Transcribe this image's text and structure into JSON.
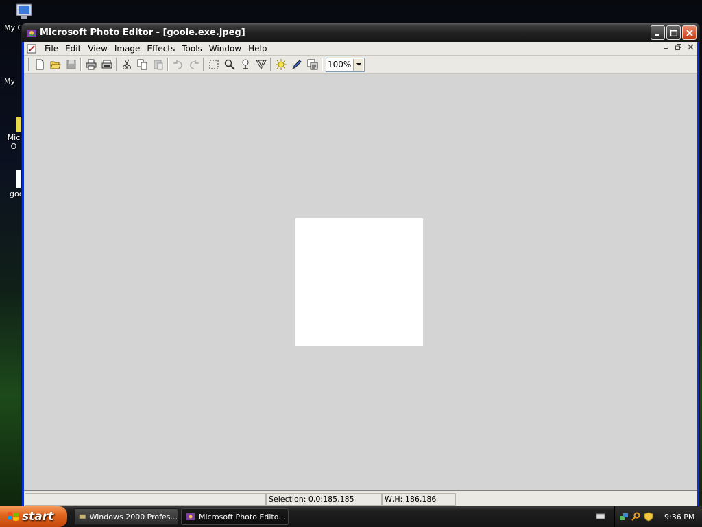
{
  "desktop": {
    "icons": [
      {
        "label": "My C",
        "icon": "my-computer-icon"
      },
      {
        "label": "My",
        "icon": "my-documents-icon"
      },
      {
        "label": "Mic O",
        "icon": "microsoft-outlook-icon"
      },
      {
        "label": "goo",
        "icon": "file-icon"
      }
    ]
  },
  "window": {
    "title": "Microsoft Photo Editor - [goole.exe.jpeg]",
    "buttons": {
      "minimize": "minimize-icon",
      "maximize": "maximize-icon",
      "close": "close-icon"
    }
  },
  "menu": {
    "items": [
      "File",
      "Edit",
      "View",
      "Image",
      "Effects",
      "Tools",
      "Window",
      "Help"
    ]
  },
  "toolbar": {
    "tools": [
      "new-icon",
      "open-icon",
      "save-icon",
      "print-icon",
      "print-preview-icon",
      "cut-icon",
      "copy-icon",
      "paste-icon",
      "undo-icon",
      "redo-icon",
      "select-icon",
      "zoom-icon",
      "smudge-icon",
      "transparency-icon",
      "balance-icon",
      "pen-icon",
      "image-properties-icon"
    ],
    "zoom_value": "100%"
  },
  "statusbar": {
    "selection": "Selection: 0,0:185,185",
    "size": "W,H: 186,186"
  },
  "taskbar": {
    "start_label": "start",
    "tasks": [
      {
        "label": "Windows 2000 Profes...",
        "active": false
      },
      {
        "label": "Microsoft Photo Edito...",
        "active": true
      }
    ],
    "clock": "9:36 PM"
  },
  "colors": {
    "titlebar": "#222222",
    "workspace": "#d4d4d4",
    "image": "#ffffff",
    "start_button": "#e2661e"
  }
}
